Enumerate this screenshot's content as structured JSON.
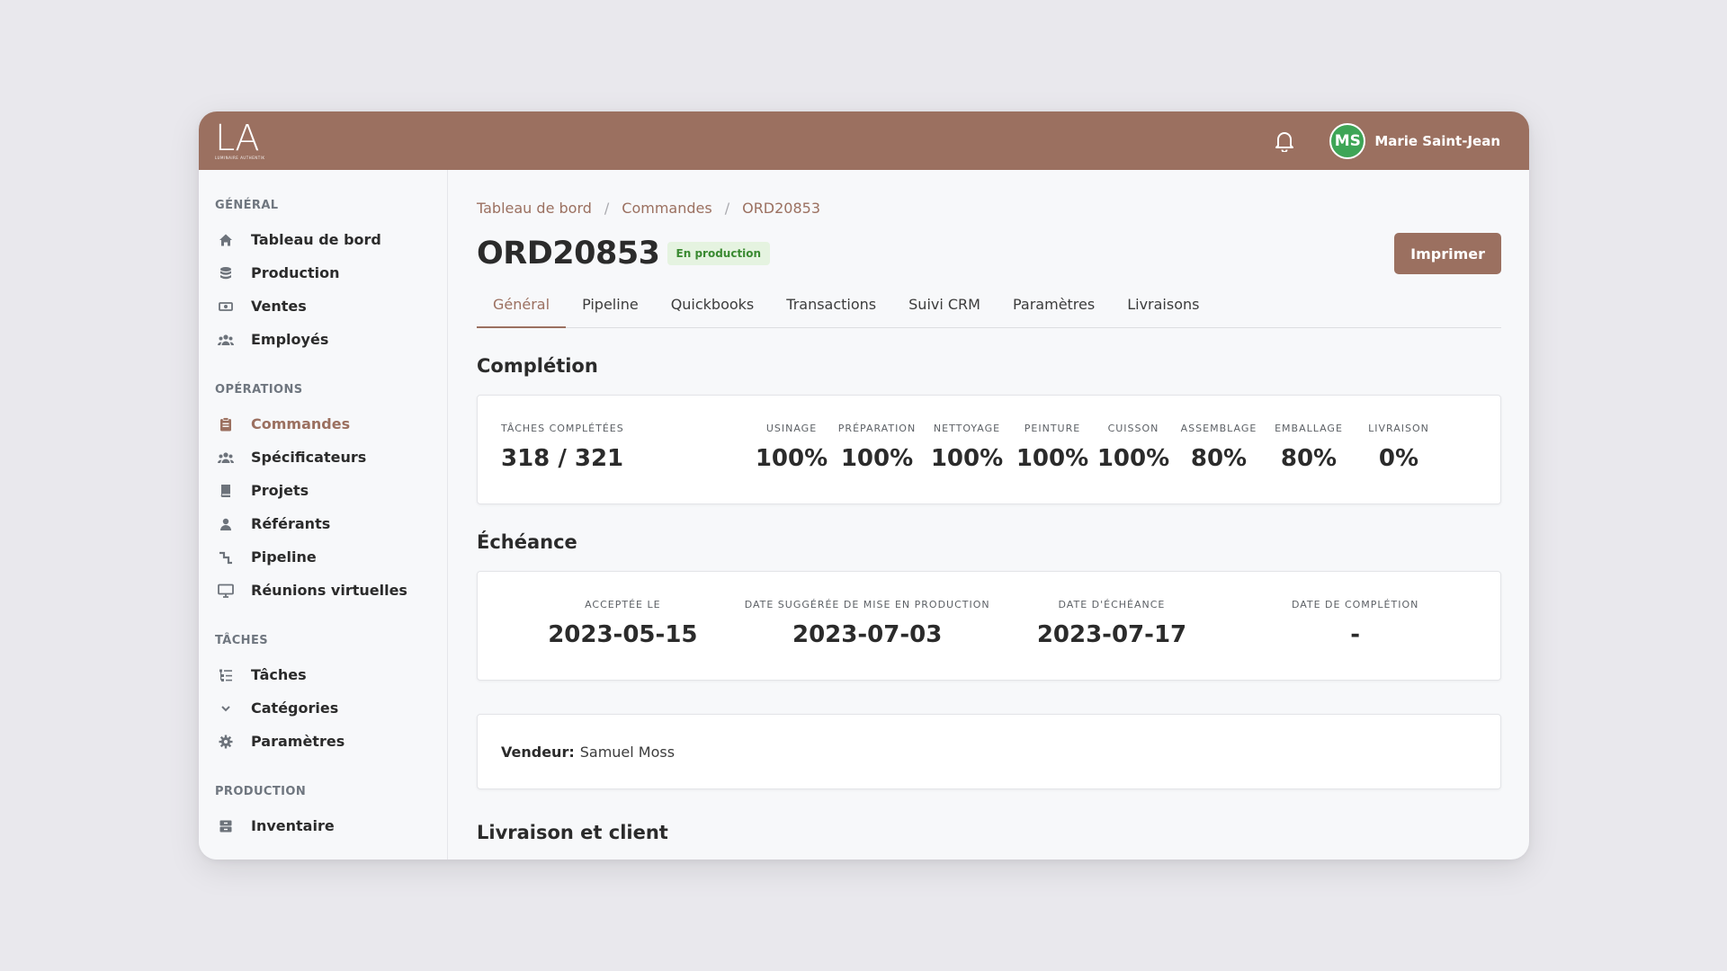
{
  "brand": {
    "logo_main": "LA",
    "logo_sub": "LUMINAIRE AUTHENTIK"
  },
  "user": {
    "initials": "MS",
    "name": "Marie Saint-Jean",
    "avatar_color": "#3ea556"
  },
  "colors": {
    "accent": "#9b7060",
    "badge_bg": "#e5f3e0",
    "badge_text": "#3a8a31"
  },
  "sidebar": {
    "groups": [
      {
        "title": "GÉNÉRAL",
        "items": [
          {
            "label": "Tableau de bord",
            "icon": "home-icon"
          },
          {
            "label": "Production",
            "icon": "database-icon"
          },
          {
            "label": "Ventes",
            "icon": "cash-icon"
          },
          {
            "label": "Employés",
            "icon": "users-icon"
          }
        ]
      },
      {
        "title": "OPÉRATIONS",
        "items": [
          {
            "label": "Commandes",
            "icon": "clipboard-icon",
            "active": true
          },
          {
            "label": "Spécificateurs",
            "icon": "users-icon"
          },
          {
            "label": "Projets",
            "icon": "book-icon"
          },
          {
            "label": "Référants",
            "icon": "user-icon"
          },
          {
            "label": "Pipeline",
            "icon": "pipeline-icon"
          },
          {
            "label": "Réunions virtuelles",
            "icon": "monitor-icon"
          }
        ]
      },
      {
        "title": "TÂCHES",
        "items": [
          {
            "label": "Tâches",
            "icon": "tasks-icon"
          },
          {
            "label": "Catégories",
            "icon": "chevron-down-icon"
          },
          {
            "label": "Paramètres",
            "icon": "gear-icon"
          }
        ]
      },
      {
        "title": "PRODUCTION",
        "items": [
          {
            "label": "Inventaire",
            "icon": "archive-icon"
          }
        ]
      }
    ]
  },
  "breadcrumb": [
    "Tableau de bord",
    "Commandes",
    "ORD20853"
  ],
  "order": {
    "title": "ORD20853",
    "status": "En production"
  },
  "print_label": "Imprimer",
  "tabs": [
    "Général",
    "Pipeline",
    "Quickbooks",
    "Transactions",
    "Suivi CRM",
    "Paramètres",
    "Livraisons"
  ],
  "completion": {
    "heading": "Complétion",
    "tasks_label": "TÂCHES COMPLÉTÉES",
    "tasks_value": "318 / 321",
    "stages": [
      {
        "label": "USINAGE",
        "value": "100%"
      },
      {
        "label": "PRÉPARATION",
        "value": "100%"
      },
      {
        "label": "NETTOYAGE",
        "value": "100%"
      },
      {
        "label": "PEINTURE",
        "value": "100%"
      },
      {
        "label": "CUISSON",
        "value": "100%"
      },
      {
        "label": "ASSEMBLAGE",
        "value": "80%"
      },
      {
        "label": "EMBALLAGE",
        "value": "80%"
      },
      {
        "label": "LIVRAISON",
        "value": "0%"
      }
    ]
  },
  "deadline": {
    "heading": "Échéance",
    "items": [
      {
        "label": "ACCEPTÉE LE",
        "value": "2023-05-15"
      },
      {
        "label": "DATE SUGGÉRÉE DE MISE EN PRODUCTION",
        "value": "2023-07-03"
      },
      {
        "label": "DATE D'ÉCHÉANCE",
        "value": "2023-07-17"
      },
      {
        "label": "DATE DE COMPLÉTION",
        "value": "-"
      }
    ]
  },
  "vendor": {
    "label": "Vendeur:",
    "value": "Samuel Moss"
  },
  "next_heading": "Livraison et client"
}
